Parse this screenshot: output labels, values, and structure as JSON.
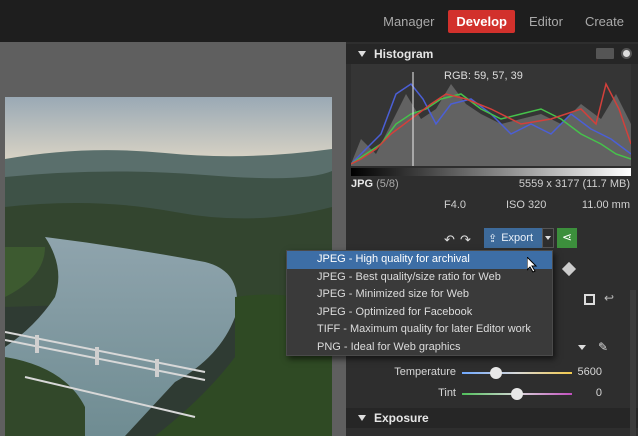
{
  "topnav": {
    "tabs": [
      {
        "label": "Manager"
      },
      {
        "label": "Develop"
      },
      {
        "label": "Editor"
      },
      {
        "label": "Create"
      }
    ],
    "active": "Develop",
    "accent": "#d2312c"
  },
  "histogram": {
    "title": "Histogram",
    "rgb_readout": "RGB: 59, 57, 39"
  },
  "file_info": {
    "format": "JPG",
    "index": "(5/8)",
    "dimensions": "5559 x 3177 (11.7 MB)",
    "aperture": "F4.0",
    "iso": "ISO 320",
    "focal": "11.00 mm"
  },
  "toolbar": {
    "export_label": "Export"
  },
  "export_menu": {
    "items": [
      "JPEG - High quality for archival",
      "JPEG - Best quality/size ratio for Web",
      "JPEG - Minimized size for Web",
      "JPEG - Optimized for Facebook",
      "TIFF - Maximum quality for later Editor work",
      "PNG - Ideal for Web graphics"
    ],
    "selected_index": 0,
    "highlight_color": "#3d6ea6"
  },
  "white_balance": {
    "temperature_label": "Temperature",
    "temperature_value": "5600",
    "tint_label": "Tint",
    "tint_value": "0"
  },
  "exposure": {
    "title": "Exposure"
  }
}
